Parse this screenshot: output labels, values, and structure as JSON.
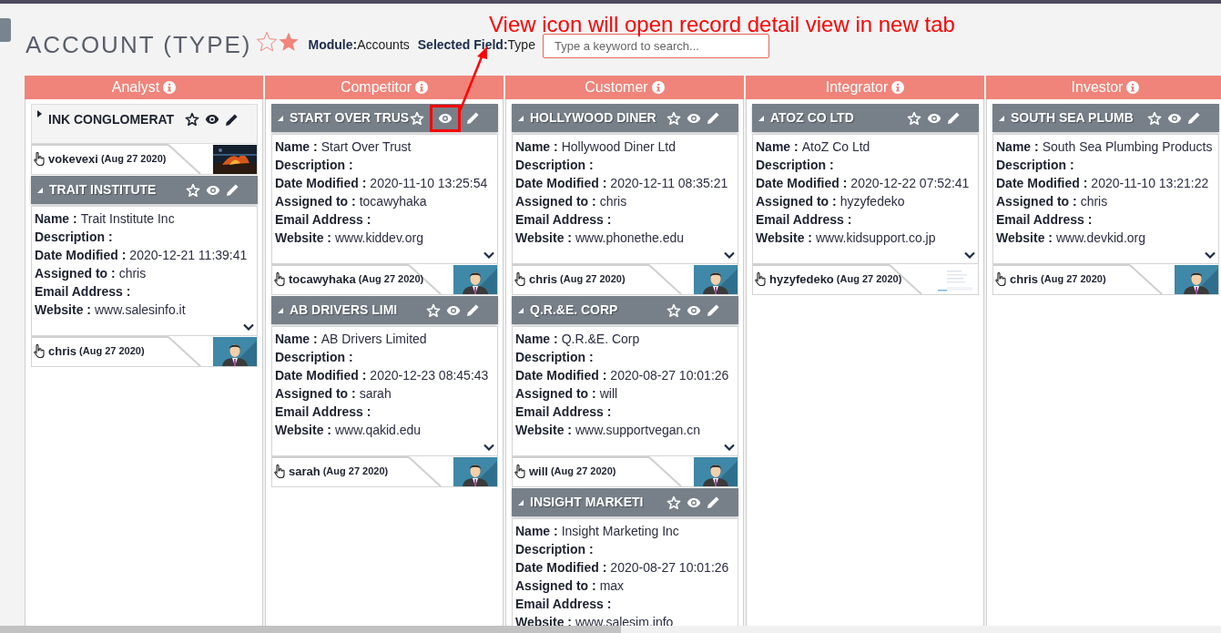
{
  "page": {
    "title": "ACCOUNT (TYPE)",
    "module_label": "Module:",
    "module_value": "Accounts",
    "field_label": "Selected Field:",
    "field_value": "Type",
    "search": {
      "placeholder": "Type a keyword to search..."
    }
  },
  "annotation": {
    "text": "View icon will open record detail view in new tab"
  },
  "columns": [
    {
      "title": "Analyst",
      "cards": [
        {
          "title": "INK CONGLOMERAT",
          "expanded": false,
          "user": "vokevexi",
          "date": "(Aug 27 2020)",
          "view_highlighted": false
        },
        {
          "title": "TRAIT INSTITUTE",
          "expanded": true,
          "fields": [
            {
              "label": "Name :",
              "value": "Trait Institute Inc"
            },
            {
              "label": "Description :"
            },
            {
              "label": "Date Modified :",
              "value": "2020-12-21 11:39:41"
            },
            {
              "label": "Assigned to :",
              "value": "chris"
            },
            {
              "label": "Email Address :"
            },
            {
              "label": "Website :",
              "value": "www.salesinfo.it"
            }
          ],
          "user": "chris",
          "date": "(Aug 27 2020)",
          "view_highlighted": false
        }
      ]
    },
    {
      "title": "Competitor",
      "cards": [
        {
          "title": "START OVER TRUS",
          "expanded": true,
          "fields": [
            {
              "label": "Name :",
              "value": "Start Over Trust"
            },
            {
              "label": "Description :"
            },
            {
              "label": "Date Modified :",
              "value": "2020-11-10 13:25:54"
            },
            {
              "label": "Assigned to :",
              "value": "tocawyhaka"
            },
            {
              "label": "Email Address :"
            },
            {
              "label": "Website :",
              "value": "www.kiddev.org"
            }
          ],
          "user": "tocawyhaka",
          "date": "(Aug 27 2020)",
          "view_highlighted": true
        },
        {
          "title": "AB DRIVERS LIMI",
          "expanded": true,
          "fields": [
            {
              "label": "Name :",
              "value": "AB Drivers Limited"
            },
            {
              "label": "Description :"
            },
            {
              "label": "Date Modified :",
              "value": "2020-12-23 08:45:43"
            },
            {
              "label": "Assigned to :",
              "value": "sarah"
            },
            {
              "label": "Email Address :"
            },
            {
              "label": "Website :",
              "value": "www.qakid.edu"
            }
          ],
          "user": "sarah",
          "date": "(Aug 27 2020)",
          "view_highlighted": false
        }
      ]
    },
    {
      "title": "Customer",
      "cards": [
        {
          "title": "HOLLYWOOD DINER",
          "expanded": true,
          "fields": [
            {
              "label": "Name :",
              "value": "Hollywood Diner Ltd"
            },
            {
              "label": "Description :"
            },
            {
              "label": "Date Modified :",
              "value": "2020-12-11 08:35:21"
            },
            {
              "label": "Assigned to :",
              "value": "chris"
            },
            {
              "label": "Email Address :"
            },
            {
              "label": "Website :",
              "value": "www.phonethe.edu"
            }
          ],
          "user": "chris",
          "date": "(Aug 27 2020)",
          "view_highlighted": false
        },
        {
          "title": "Q.R.&E. CORP",
          "expanded": true,
          "fields": [
            {
              "label": "Name :",
              "value": "Q.R.&E. Corp"
            },
            {
              "label": "Description :"
            },
            {
              "label": "Date Modified :",
              "value": "2020-08-27 10:01:26"
            },
            {
              "label": "Assigned to :",
              "value": "will"
            },
            {
              "label": "Email Address :"
            },
            {
              "label": "Website :",
              "value": "www.supportvegan.cn"
            }
          ],
          "user": "will",
          "date": "(Aug 27 2020)",
          "view_highlighted": false
        },
        {
          "title": "INSIGHT MARKETI",
          "expanded": true,
          "fields": [
            {
              "label": "Name :",
              "value": "Insight Marketing Inc"
            },
            {
              "label": "Description :"
            },
            {
              "label": "Date Modified :",
              "value": "2020-08-27 10:01:26"
            },
            {
              "label": "Assigned to :",
              "value": "max"
            },
            {
              "label": "Email Address :"
            },
            {
              "label": "Website :",
              "value": "www.salesim.info"
            }
          ],
          "view_highlighted": false
        }
      ]
    },
    {
      "title": "Integrator",
      "cards": [
        {
          "title": "ATOZ CO LTD",
          "expanded": true,
          "fields": [
            {
              "label": "Name :",
              "value": "AtoZ Co Ltd"
            },
            {
              "label": "Description :"
            },
            {
              "label": "Date Modified :",
              "value": "2020-12-22 07:52:41"
            },
            {
              "label": "Assigned to :",
              "value": "hyzyfedeko"
            },
            {
              "label": "Email Address :"
            },
            {
              "label": "Website :",
              "value": "www.kidsupport.co.jp"
            }
          ],
          "user": "hyzyfedeko",
          "date": "(Aug 27 2020)",
          "view_highlighted": false
        }
      ]
    },
    {
      "title": "Investor",
      "cards": [
        {
          "title": "SOUTH SEA PLUMB",
          "expanded": true,
          "fields": [
            {
              "label": "Name :",
              "value": "South Sea Plumbing Products"
            },
            {
              "label": "Description :"
            },
            {
              "label": "Date Modified :",
              "value": "2020-11-10 13:21:22"
            },
            {
              "label": "Assigned to :",
              "value": "chris"
            },
            {
              "label": "Email Address :"
            },
            {
              "label": "Website :",
              "value": "www.devkid.org"
            }
          ],
          "user": "chris",
          "date": "(Aug 27 2020)",
          "view_highlighted": false
        }
      ]
    }
  ]
}
